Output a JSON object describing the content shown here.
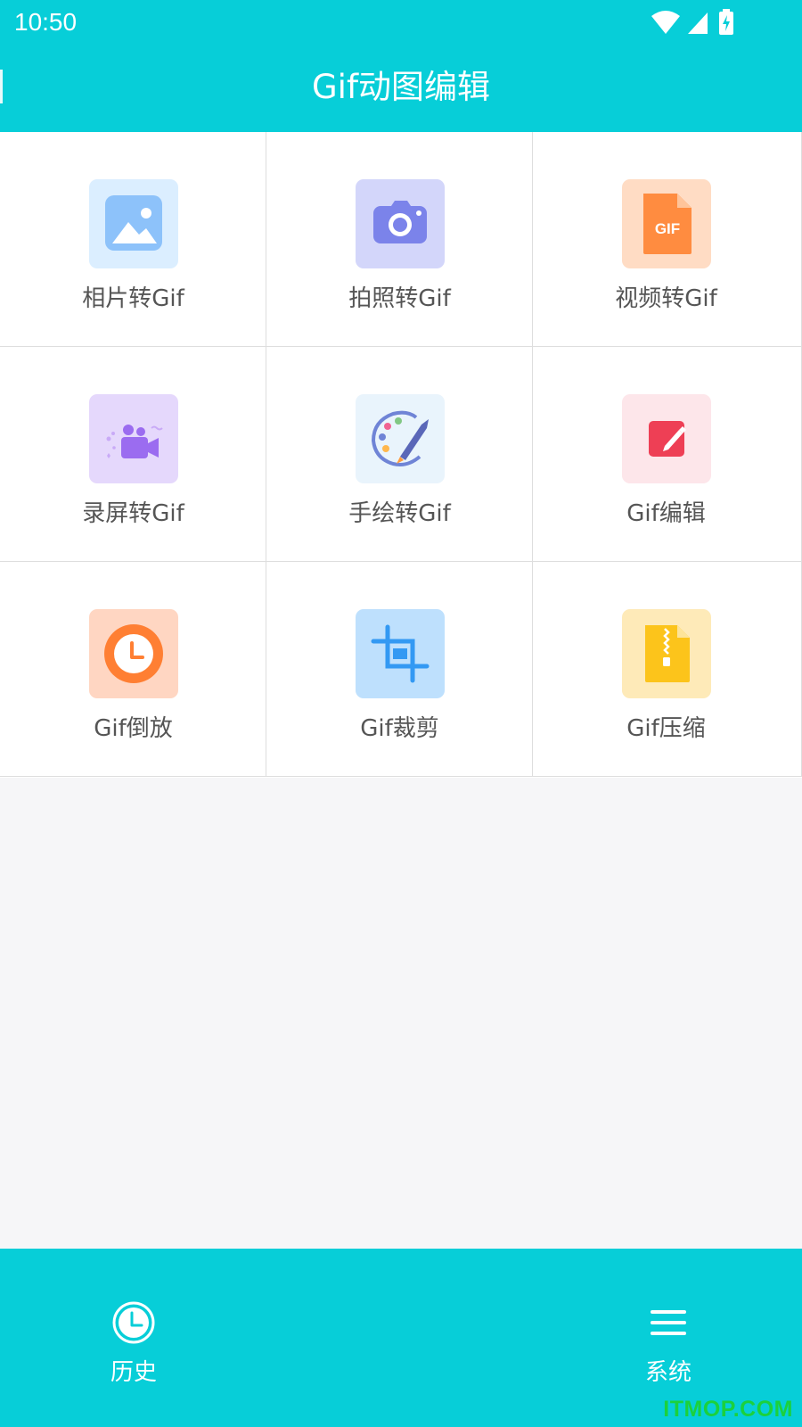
{
  "status_bar": {
    "time": "10:50",
    "icons": [
      "wifi-icon",
      "cell-signal-icon",
      "battery-charging-icon"
    ]
  },
  "header": {
    "title": "Gif动图编辑"
  },
  "tools": [
    {
      "label": "相片转Gif",
      "icon": "photo-icon"
    },
    {
      "label": "拍照转Gif",
      "icon": "camera-icon"
    },
    {
      "label": "视频转Gif",
      "icon": "gif-file-icon"
    },
    {
      "label": "录屏转Gif",
      "icon": "video-camera-icon"
    },
    {
      "label": "手绘转Gif",
      "icon": "palette-brush-icon"
    },
    {
      "label": "Gif编辑",
      "icon": "edit-icon"
    },
    {
      "label": "Gif倒放",
      "icon": "clock-icon"
    },
    {
      "label": "Gif裁剪",
      "icon": "crop-icon"
    },
    {
      "label": "Gif压缩",
      "icon": "zip-file-icon"
    }
  ],
  "bottom_nav": {
    "history": {
      "label": "历史",
      "icon": "clock-icon"
    },
    "system": {
      "label": "系统",
      "icon": "menu-icon"
    }
  },
  "watermark": "ITMOP.COM",
  "colors": {
    "accent": "#07ced8",
    "background": "#f6f6f8",
    "label": "#555555",
    "watermark": "#1bd13c"
  }
}
